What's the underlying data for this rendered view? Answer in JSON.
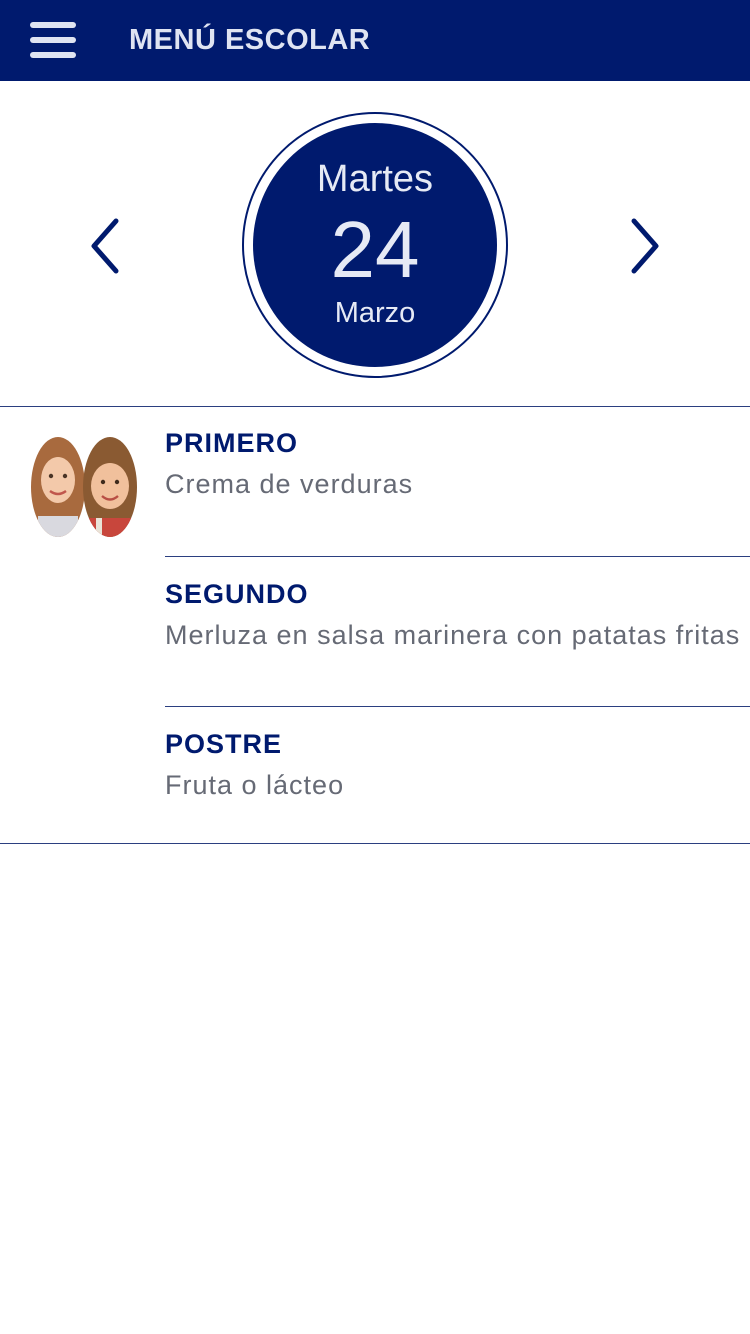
{
  "header": {
    "title": "MENÚ ESCOLAR",
    "menu_icon": "hamburger-menu-icon"
  },
  "colors": {
    "brand_navy": "#001a6e",
    "header_text": "#dfe4f2",
    "dish_text": "#666a75",
    "background": "#ffffff"
  },
  "date": {
    "weekday": "Martes",
    "day": "24",
    "month": "Marzo",
    "prev_icon": "chevron-left-icon",
    "next_icon": "chevron-right-icon"
  },
  "menu": {
    "avatar_icon": "children-photo-avatar",
    "courses": [
      {
        "title": "PRIMERO",
        "dish": "Crema de verduras"
      },
      {
        "title": "SEGUNDO",
        "dish": "Merluza en salsa marinera con patatas fritas"
      },
      {
        "title": "POSTRE",
        "dish": "Fruta o lácteo"
      }
    ]
  }
}
